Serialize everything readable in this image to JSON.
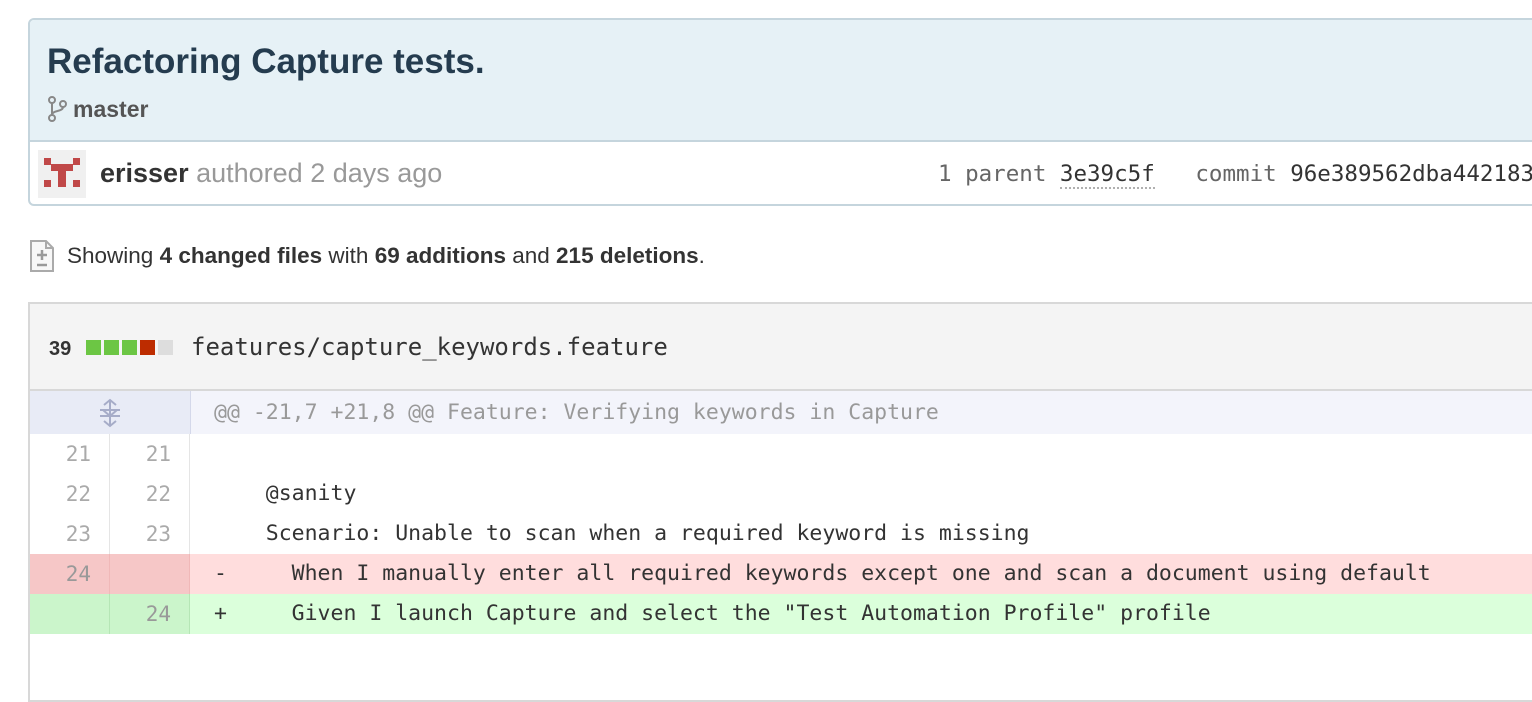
{
  "commit": {
    "title": "Refactoring Capture tests.",
    "branch": "master",
    "author": "erisser",
    "authored_text": "authored 2 days ago",
    "parent_label": "1 parent",
    "parent_sha": "3e39c5f",
    "commit_label": "commit",
    "commit_sha": "96e389562dba442183"
  },
  "summary": {
    "showing": "Showing",
    "changed_files": "4 changed files",
    "with": "with",
    "additions": "69 additions",
    "and": "and",
    "deletions": "215 deletions",
    "period": "."
  },
  "file": {
    "changes": "39",
    "path": "features/capture_keywords.feature",
    "diffstat_colors": [
      "#6cc644",
      "#6cc644",
      "#6cc644",
      "#bd2c00",
      "#dddddd"
    ],
    "hunk": "@@ -21,7 +21,8 @@ Feature: Verifying keywords in Capture",
    "lines": [
      {
        "old": "21",
        "new": "21",
        "code": "  "
      },
      {
        "old": "22",
        "new": "22",
        "code": "    @sanity"
      },
      {
        "old": "23",
        "new": "23",
        "code": "    Scenario: Unable to scan when a required keyword is missing"
      },
      {
        "old": "24",
        "new": "",
        "code": "-     When I manually enter all required keywords except one and scan a document using default"
      },
      {
        "old": "",
        "new": "24",
        "code": "+     Given I launch Capture and select the \"Test Automation Profile\" profile"
      }
    ]
  },
  "colors": {
    "added": "#dbffdb",
    "deleted": "#ffdddd",
    "hunk": "#f3f4fb"
  },
  "icons": {
    "branch": "branch-icon",
    "avatar": "identicon-avatar",
    "diff_file": "file-diff-icon",
    "expand": "expand-lines-icon"
  }
}
